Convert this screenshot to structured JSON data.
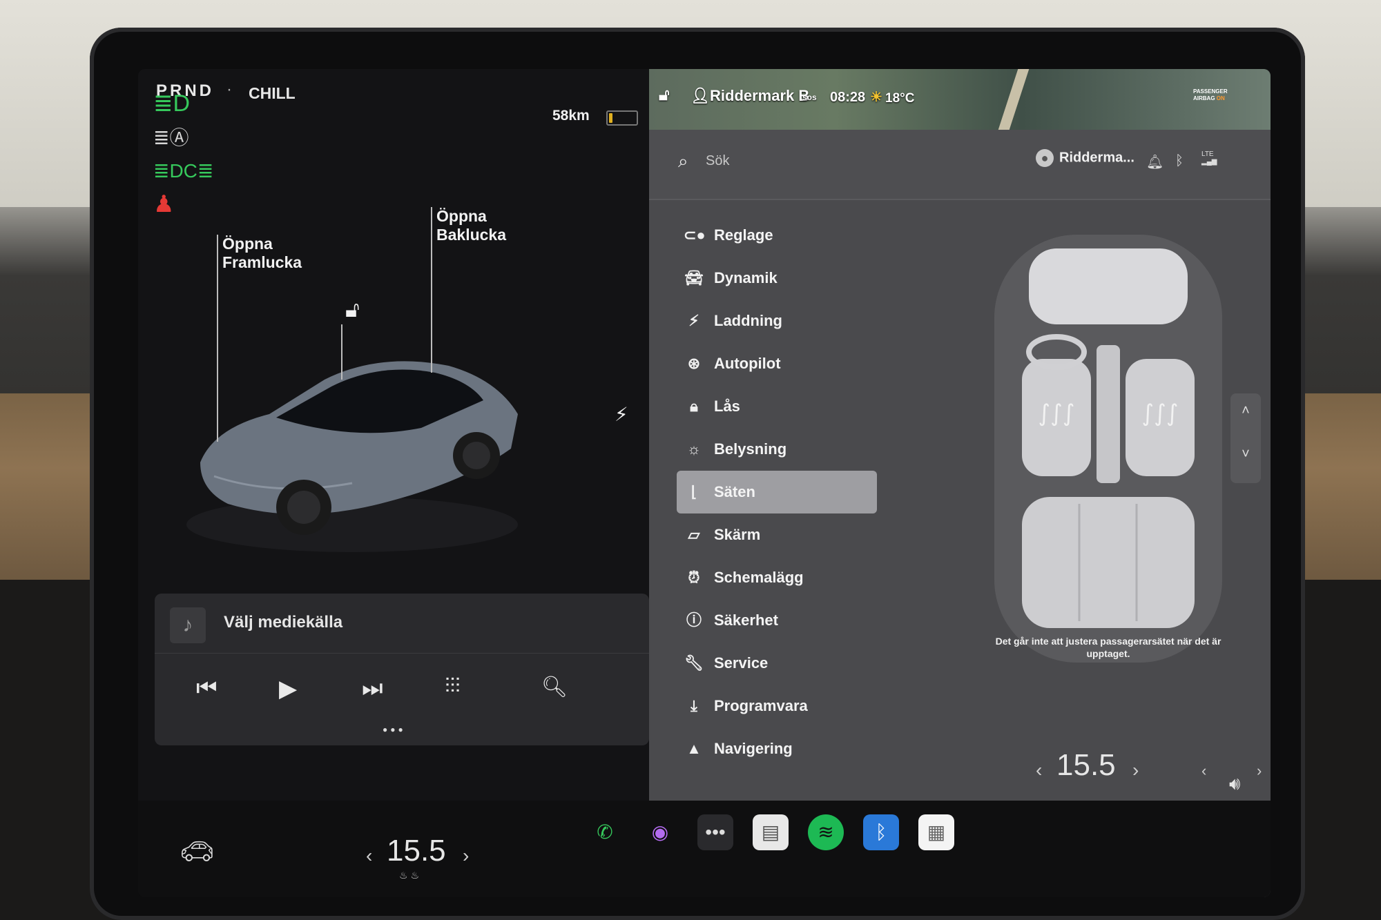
{
  "status": {
    "gear": "PRND",
    "separator": "·",
    "drive_mode": "CHILL",
    "range": "58km",
    "battery_fraction": 0.12
  },
  "car_view": {
    "open_frunk": "Öppna\nFramlucka",
    "open_trunk": "Öppna\nBaklucka"
  },
  "media": {
    "source_label": "Välj mediekälla"
  },
  "topbar": {
    "location": "Riddermark B",
    "sos": "sos",
    "time": "08:28",
    "temperature": "18°C",
    "airbag_line1": "PASSENGER",
    "airbag_line2": "AIRBAG",
    "airbag_state": "ON"
  },
  "search": {
    "placeholder": "Sök"
  },
  "profile": {
    "name": "Ridderma..."
  },
  "lte_label": "LTE",
  "menu": [
    {
      "label": "Reglage",
      "icon": "toggle-icon"
    },
    {
      "label": "Dynamik",
      "icon": "car-icon"
    },
    {
      "label": "Laddning",
      "icon": "bolt-icon"
    },
    {
      "label": "Autopilot",
      "icon": "steering-wheel-icon"
    },
    {
      "label": "Lås",
      "icon": "lock-icon"
    },
    {
      "label": "Belysning",
      "icon": "sun-icon"
    },
    {
      "label": "Säten",
      "icon": "seat-icon",
      "active": true
    },
    {
      "label": "Skärm",
      "icon": "screen-icon"
    },
    {
      "label": "Schemalägg",
      "icon": "alarm-clock-icon"
    },
    {
      "label": "Säkerhet",
      "icon": "info-icon"
    },
    {
      "label": "Service",
      "icon": "wrench-icon"
    },
    {
      "label": "Programvara",
      "icon": "download-icon"
    },
    {
      "label": "Navigering",
      "icon": "navigation-icon"
    }
  ],
  "seats": {
    "note": "Det går inte att justera passagerarsätet när det är upptaget."
  },
  "climate": {
    "driver_temp": "15.5",
    "passenger_temp": "15.5"
  },
  "colors": {
    "headlight_green": "#36c95c",
    "seatbelt_red": "#e53935",
    "active_menu_bg": "#9e9ea2",
    "panel_bg": "#4a4a4d"
  }
}
